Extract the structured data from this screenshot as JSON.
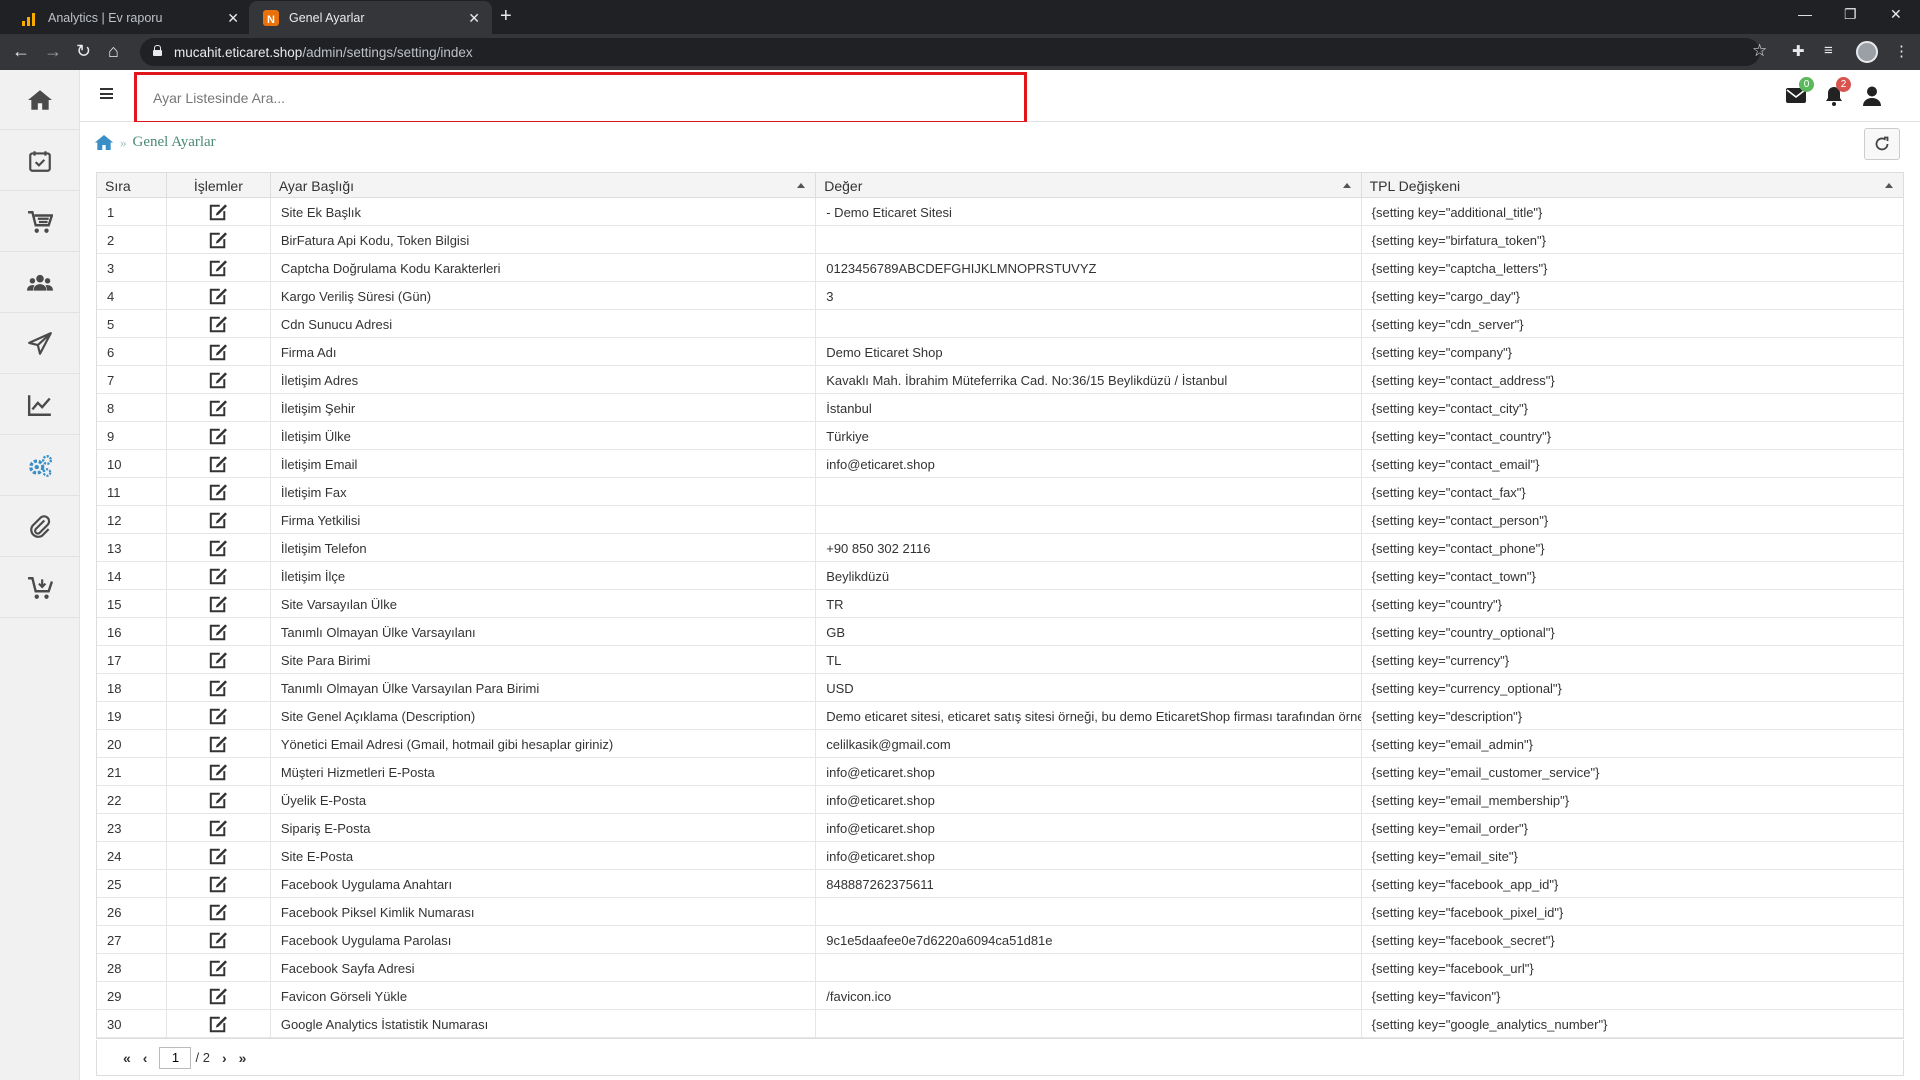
{
  "browser": {
    "tabs": [
      {
        "title": "Analytics | Ev raporu",
        "active": false
      },
      {
        "title": "Genel Ayarlar",
        "active": true
      }
    ],
    "url_host": "mucahit.eticaret.shop",
    "url_path": "/admin/settings/setting/index"
  },
  "topbar": {
    "search_placeholder": "Ayar Listesinde Ara...",
    "mail_badge": "0",
    "notif_badge": "2"
  },
  "breadcrumb": {
    "current": "Genel Ayarlar"
  },
  "table": {
    "headers": [
      "Sıra",
      "İşlemler",
      "Ayar Başlığı",
      "Değer",
      "TPL Değişkeni"
    ],
    "rows": [
      [
        "1",
        "Site Ek Başlık",
        "- Demo Eticaret Sitesi",
        "{setting key=\"additional_title\"}"
      ],
      [
        "2",
        "BirFatura Api Kodu, Token Bilgisi",
        "",
        "{setting key=\"birfatura_token\"}"
      ],
      [
        "3",
        "Captcha Doğrulama Kodu Karakterleri",
        "0123456789ABCDEFGHIJKLMNOPRSTUVYZ",
        "{setting key=\"captcha_letters\"}"
      ],
      [
        "4",
        "Kargo Veriliş Süresi (Gün)",
        "3",
        "{setting key=\"cargo_day\"}"
      ],
      [
        "5",
        "Cdn Sunucu Adresi",
        "",
        "{setting key=\"cdn_server\"}"
      ],
      [
        "6",
        "Firma Adı",
        "Demo Eticaret Shop",
        "{setting key=\"company\"}"
      ],
      [
        "7",
        "İletişim Adres",
        "Kavaklı Mah. İbrahim Müteferrika Cad. No:36/15 Beylikdüzü / İstanbul",
        "{setting key=\"contact_address\"}"
      ],
      [
        "8",
        "İletişim Şehir",
        "İstanbul",
        "{setting key=\"contact_city\"}"
      ],
      [
        "9",
        "İletişim Ülke",
        "Türkiye",
        "{setting key=\"contact_country\"}"
      ],
      [
        "10",
        "İletişim Email",
        "info@eticaret.shop",
        "{setting key=\"contact_email\"}"
      ],
      [
        "11",
        "İletişim Fax",
        "",
        "{setting key=\"contact_fax\"}"
      ],
      [
        "12",
        "Firma Yetkilisi",
        "",
        "{setting key=\"contact_person\"}"
      ],
      [
        "13",
        "İletişim Telefon",
        "+90 850 302 2116",
        "{setting key=\"contact_phone\"}"
      ],
      [
        "14",
        "İletişim İlçe",
        "Beylikdüzü",
        "{setting key=\"contact_town\"}"
      ],
      [
        "15",
        "Site Varsayılan Ülke",
        "TR",
        "{setting key=\"country\"}"
      ],
      [
        "16",
        "Tanımlı Olmayan Ülke Varsayılanı",
        "GB",
        "{setting key=\"country_optional\"}"
      ],
      [
        "17",
        "Site Para Birimi",
        "TL",
        "{setting key=\"currency\"}"
      ],
      [
        "18",
        "Tanımlı Olmayan Ülke Varsayılan Para Birimi",
        "USD",
        "{setting key=\"currency_optional\"}"
      ],
      [
        "19",
        "Site Genel Açıklama (Description)",
        "Demo eticaret sitesi, eticaret satış sitesi örneği, bu demo EticaretShop firması tarafından örne",
        "{setting key=\"description\"}"
      ],
      [
        "20",
        "Yönetici Email Adresi (Gmail, hotmail gibi hesaplar giriniz)",
        "celilkasik@gmail.com",
        "{setting key=\"email_admin\"}"
      ],
      [
        "21",
        "Müşteri Hizmetleri E-Posta",
        "info@eticaret.shop",
        "{setting key=\"email_customer_service\"}"
      ],
      [
        "22",
        "Üyelik E-Posta",
        "info@eticaret.shop",
        "{setting key=\"email_membership\"}"
      ],
      [
        "23",
        "Sipariş E-Posta",
        "info@eticaret.shop",
        "{setting key=\"email_order\"}"
      ],
      [
        "24",
        "Site E-Posta",
        "info@eticaret.shop",
        "{setting key=\"email_site\"}"
      ],
      [
        "25",
        "Facebook Uygulama Anahtarı",
        "848887262375611",
        "{setting key=\"facebook_app_id\"}"
      ],
      [
        "26",
        "Facebook Piksel Kimlik Numarası",
        "",
        "{setting key=\"facebook_pixel_id\"}"
      ],
      [
        "27",
        "Facebook Uygulama Parolası",
        "9c1e5daafee0e7d6220a6094ca51d81e",
        "{setting key=\"facebook_secret\"}"
      ],
      [
        "28",
        "Facebook Sayfa Adresi",
        "",
        "{setting key=\"facebook_url\"}"
      ],
      [
        "29",
        "Favicon Görseli Yükle",
        "/favicon.ico",
        "{setting key=\"favicon\"}"
      ],
      [
        "30",
        "Google Analytics İstatistik Numarası",
        "",
        "{setting key=\"google_analytics_number\"}"
      ]
    ]
  },
  "pager": {
    "current_page": "1",
    "total_label": "/ 2"
  },
  "icons": {
    "sidebar": [
      "home-icon",
      "tasks-icon",
      "cart-icon",
      "users-icon",
      "send-icon",
      "chart-icon",
      "settings-icon",
      "attachment-icon",
      "cart-download-icon"
    ],
    "row_action": "edit-icon"
  },
  "colors": {
    "highlight": "#e0161c",
    "sidebar_icon": "#4a4a4a",
    "settings_icon": "#3a8fc7",
    "breadcrumb": "#4a8b73",
    "mail_badge": "#5cb85c",
    "notif_badge": "#d9534f"
  }
}
